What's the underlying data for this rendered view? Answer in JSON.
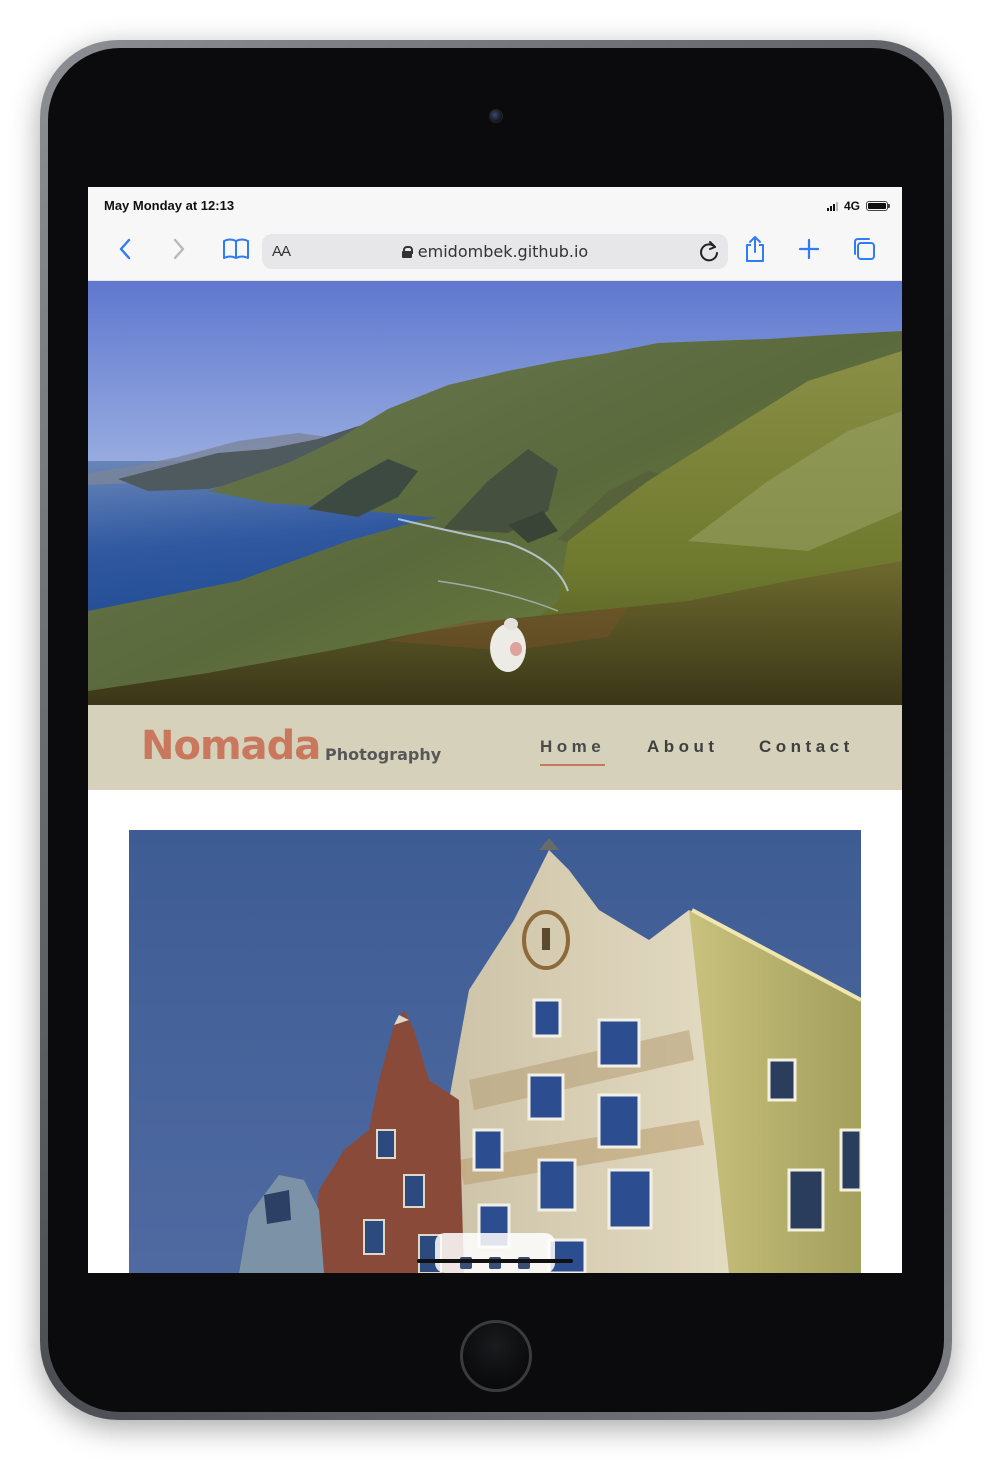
{
  "status_bar": {
    "time": "May Monday at 12:13",
    "network": "4G"
  },
  "browser": {
    "text_size_label": "AA",
    "url": "emidombek.github.io",
    "icons": [
      "back-icon",
      "forward-icon",
      "bookmarks-icon",
      "lock-icon",
      "reload-icon",
      "share-icon",
      "new-tab-icon",
      "tabs-icon"
    ]
  },
  "site": {
    "brand": "Nomada",
    "brand_sub": "Photography",
    "nav": [
      {
        "label": "Home",
        "active": true
      },
      {
        "label": "About",
        "active": false
      },
      {
        "label": "Contact",
        "active": false
      }
    ],
    "accent_color": "#c9785e",
    "nav_background": "#d6d1bb"
  }
}
